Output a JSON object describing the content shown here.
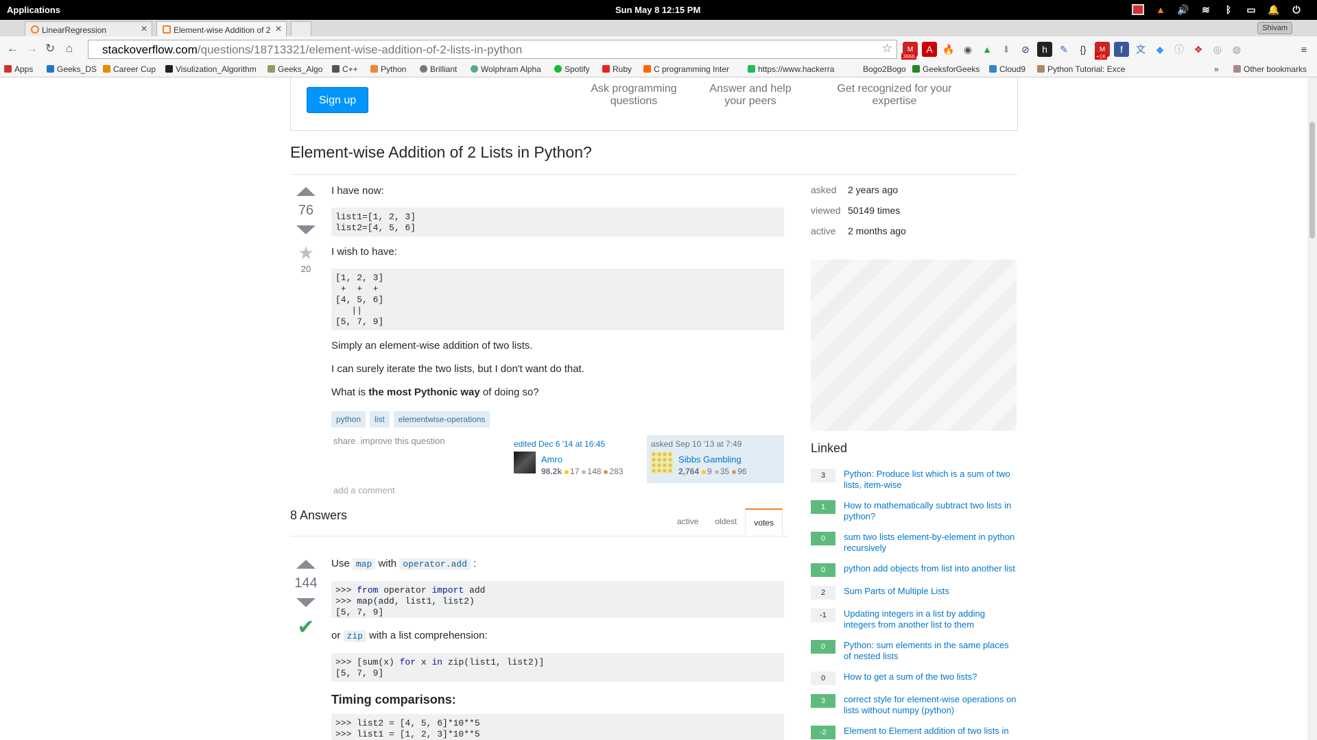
{
  "system": {
    "apps": "Applications",
    "clock": "Sun May 8   12:15 PM"
  },
  "browser": {
    "tabs": [
      {
        "label": "LinearRegression"
      },
      {
        "label": "Element-wise Addition of 2"
      }
    ],
    "user": "Shivam",
    "url_domain": "stackoverflow.com",
    "url_path": "/questions/18713321/element-wise-addition-of-2-lists-in-python",
    "ext_badge1": "3666",
    "ext_badge2": "+1K",
    "bookmarks": [
      "Apps",
      "Geeks_DS",
      "Career Cup",
      "Visulization_Algorithm",
      "Geeks_Algo",
      "C++",
      "Python",
      "Brilliant",
      "Wolphram Alpha",
      "Spotify",
      "Ruby",
      "C programming Inter",
      "https://www.hackerra",
      "Bogo2Bogo",
      "GeeksforGeeks",
      "Cloud9",
      "Python Tutorial: Exce"
    ],
    "other_bookmarks": "Other bookmarks"
  },
  "hero": {
    "signup": "Sign up",
    "points": [
      "Ask programming questions",
      "Answer and help your peers",
      "Get recognized for your expertise"
    ]
  },
  "question": {
    "title": "Element-wise Addition of 2 Lists in Python?",
    "votes": "76",
    "favorites": "20",
    "p1": "I have now:",
    "code1": "list1=[1, 2, 3]\nlist2=[4, 5, 6]",
    "p2": "I wish to have:",
    "code2": "[1, 2, 3]\n +  +  +\n[4, 5, 6]\n   ||\n[5, 7, 9]",
    "p3": "Simply an element-wise addition of two lists.",
    "p4": "I can surely iterate the two lists, but I don't want do that.",
    "p5_pre": "What is ",
    "p5_bold": "the most Pythonic way",
    "p5_post": " of doing so?",
    "tags": [
      "python",
      "list",
      "elementwise-operations"
    ],
    "share": "share",
    "improve": "improve this question",
    "edited": "edited Dec 6 '14 at 16:45",
    "editor": "Amro",
    "editor_rep": "98.2k",
    "editor_gold": "17",
    "editor_silver": "148",
    "editor_bronze": "283",
    "asked": "asked Sep 10 '13 at 7:49",
    "asker": "Sibbs Gambling",
    "asker_rep": "2,764",
    "asker_gold": "9",
    "asker_silver": "35",
    "asker_bronze": "96",
    "add_comment": "add a comment"
  },
  "answers": {
    "count": "8 Answers",
    "tabs": [
      "active",
      "oldest",
      "votes"
    ],
    "votes": "144",
    "use": "Use",
    "map": "map",
    "with": "with",
    "opadd": "operator.add",
    "colon": ":",
    "code1_l1_prompt": ">>> ",
    "code1_l1_kw1": "from",
    "code1_l1_mid": " operator ",
    "code1_l1_kw2": "import",
    "code1_l1_end": " add",
    "code1_rest": ">>> map(add, list1, list2)\n[5, 7, 9]",
    "or": "or",
    "zip": "zip",
    "with_lc": "with a list comprehension:",
    "code2_a": ">>> [sum(x) ",
    "code2_kw1": "for",
    "code2_b": " x ",
    "code2_kw2": "in",
    "code2_c": " zip(list1, list2)]\n[5, 7, 9]",
    "timing": "Timing comparisons:",
    "code3": ">>> list2 = [4, 5, 6]*10**5\n>>> list1 = [1, 2, 3]*10**5"
  },
  "sidebar": {
    "asked_l": "asked",
    "asked_v": "2 years ago",
    "viewed_l": "viewed",
    "viewed_v": "50149 times",
    "active_l": "active",
    "active_v": "2 months ago",
    "linked": "Linked",
    "items": [
      {
        "n": "3",
        "t": "Python: Produce list which is a sum of two lists, item-wise"
      },
      {
        "n": "1",
        "t": "How to mathematically subtract two lists in python?"
      },
      {
        "n": "0",
        "t": "sum two lists element-by-element in python recursively"
      },
      {
        "n": "0",
        "t": "python add objects from list into another list"
      },
      {
        "n": "2",
        "t": "Sum Parts of Multiple Lists"
      },
      {
        "n": "-1",
        "t": "Updating integers in a list by adding integers from another list to them"
      },
      {
        "n": "0",
        "t": "Python: sum elements in the same places of nested lists"
      },
      {
        "n": "0",
        "t": "How to get a sum of the two lists?"
      },
      {
        "n": "3",
        "t": "correct style for element-wise operations on lists without numpy (python)"
      },
      {
        "n": "-2",
        "t": "Element to Element addition of two lists in"
      }
    ]
  }
}
